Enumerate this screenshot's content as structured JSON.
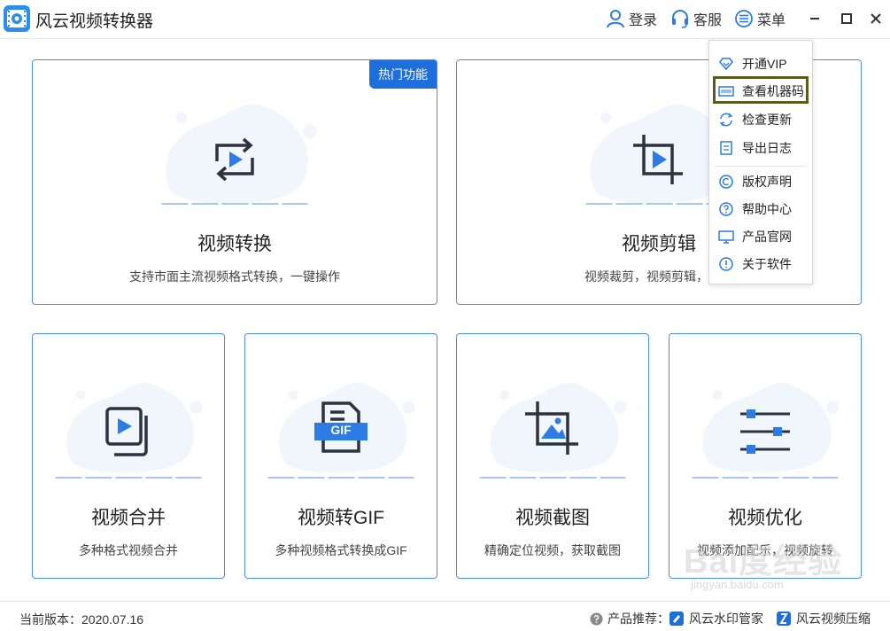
{
  "app": {
    "title": "风云视频转换器"
  },
  "titlebar": {
    "login": "登录",
    "service": "客服",
    "menu": "菜单"
  },
  "cards": [
    {
      "title": "视频转换",
      "desc": "支持市面主流视频格式转换，一键操作",
      "badge": "热门功能",
      "icon": "convert-icon"
    },
    {
      "title": "视频剪辑",
      "desc": "视频裁剪，视频剪辑，一键",
      "icon": "crop-play-icon"
    },
    {
      "title": "视频合并",
      "desc": "多种格式视频合并",
      "icon": "merge-icon"
    },
    {
      "title": "视频转GIF",
      "desc": "多种视频格式转换成GIF",
      "icon": "gif-file-icon",
      "icon_text": "GIF"
    },
    {
      "title": "视频截图",
      "desc": "精确定位视频，获取截图",
      "icon": "crop-image-icon"
    },
    {
      "title": "视频优化",
      "desc": "视频添加配乐，视频旋转",
      "icon": "sliders-icon"
    }
  ],
  "menu": {
    "items": [
      {
        "label": "开通VIP",
        "icon": "diamond-icon"
      },
      {
        "label": "查看机器码",
        "icon": "barcode-icon"
      },
      {
        "label": "检查更新",
        "icon": "refresh-icon"
      },
      {
        "label": "导出日志",
        "icon": "log-icon"
      },
      {
        "label": "版权声明",
        "icon": "copyright-icon"
      },
      {
        "label": "帮助中心",
        "icon": "help-icon"
      },
      {
        "label": "产品官网",
        "icon": "monitor-icon"
      },
      {
        "label": "关于软件",
        "icon": "info-icon"
      }
    ],
    "highlighted": "查看机器码"
  },
  "footer": {
    "version": "当前版本：2020.07.16",
    "recommend_label": "产品推荐：",
    "product_1": "风云水印管家",
    "product_2": "风云视频压缩"
  },
  "watermark": {
    "text": "Bai度经验",
    "sub": "jingyan.baidu.com"
  },
  "colors": {
    "accent": "#1e6fdc",
    "border": "#4c8ef0",
    "icon_blue": "#2d7be5",
    "icon_dark": "#2b3340"
  }
}
